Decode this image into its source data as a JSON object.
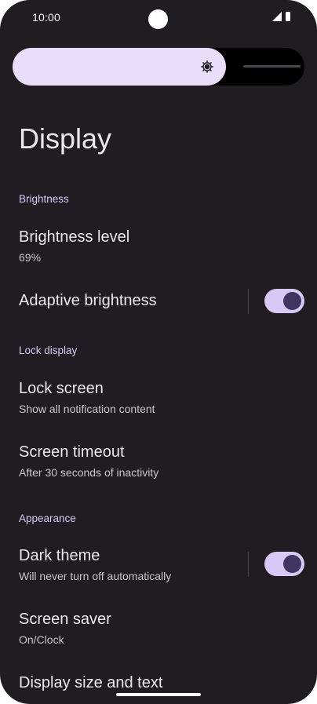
{
  "status_bar": {
    "time": "10:00"
  },
  "brightness_slider": {
    "level_fraction": 0.69,
    "fill_color": "#e8ddfa",
    "track_color": "#000000",
    "icon": "brightness-sun-icon"
  },
  "page": {
    "title": "Display"
  },
  "sections": {
    "brightness": {
      "header": "Brightness",
      "brightness_level": {
        "title": "Brightness level",
        "summary": "69%"
      },
      "adaptive_brightness": {
        "title": "Adaptive brightness",
        "enabled": true
      }
    },
    "lock_display": {
      "header": "Lock display",
      "lock_screen": {
        "title": "Lock screen",
        "summary": "Show all notification content"
      },
      "screen_timeout": {
        "title": "Screen timeout",
        "summary": "After 30 seconds of inactivity"
      }
    },
    "appearance": {
      "header": "Appearance",
      "dark_theme": {
        "title": "Dark theme",
        "summary": "Will never turn off automatically",
        "enabled": true
      },
      "screen_saver": {
        "title": "Screen saver",
        "summary": "On/Clock"
      },
      "display_size": {
        "title": "Display size and text"
      }
    }
  },
  "colors": {
    "background": "#201d22",
    "accent": "#d6c9f6",
    "primary_text": "#ece6ee",
    "secondary_text": "#c9c4cc",
    "switch_thumb": "#3f3561"
  }
}
